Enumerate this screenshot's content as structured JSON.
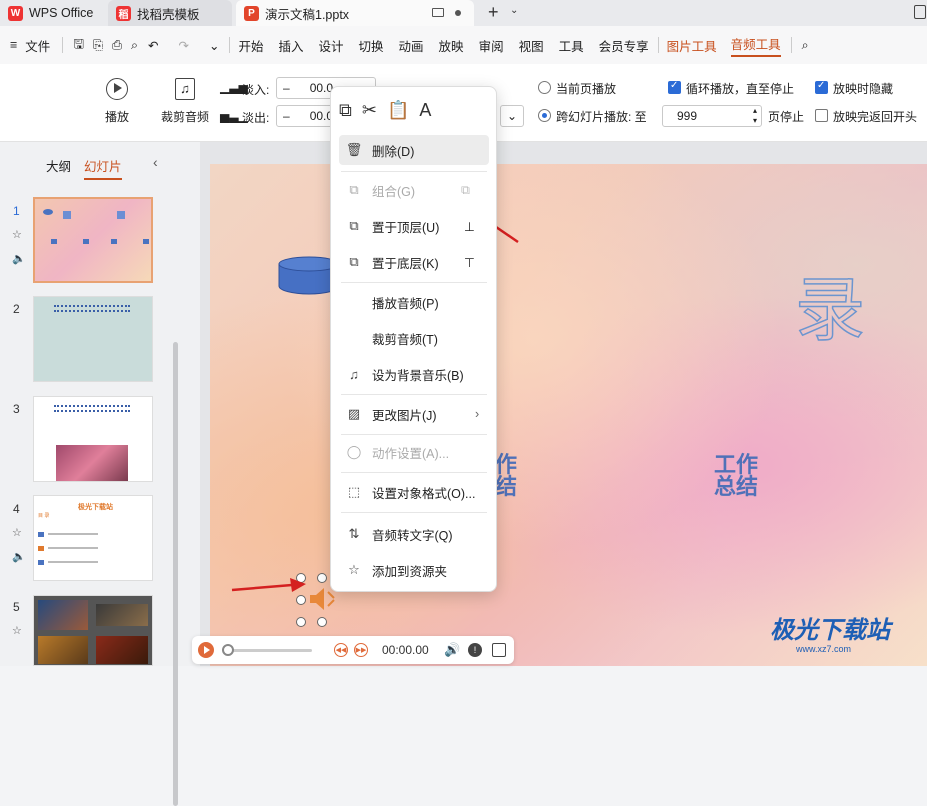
{
  "titlebar": {
    "tabs": [
      {
        "label": "WPS Office"
      },
      {
        "label": "找稻壳模板"
      },
      {
        "label": "演示文稿1.pptx"
      }
    ]
  },
  "menubar": {
    "file": "文件",
    "items": [
      "开始",
      "插入",
      "设计",
      "切换",
      "动画",
      "放映",
      "审阅",
      "视图",
      "工具",
      "会员专享"
    ],
    "context_tabs": [
      "图片工具",
      "音频工具"
    ]
  },
  "ribbon": {
    "play": "播放",
    "trim": "裁剪音频",
    "fade_in_label": "淡入:",
    "fade_in_value": "00.0",
    "fade_out_label": "淡出:",
    "fade_out_value": "00.0",
    "current_page_play": "当前页播放",
    "cross_slide_play": "跨幻灯片播放: 至",
    "page_stop_value": "999",
    "page_stop": "页停止",
    "loop_play": "循环播放，直至停止",
    "hide_on_show": "放映时隐藏",
    "rewind_after": "放映完返回开头",
    "accent_color": "#2b6bd6"
  },
  "leftpane": {
    "tab_outline": "大纲",
    "tab_slides": "幻灯片",
    "slides": [
      {
        "num": "1"
      },
      {
        "num": "2"
      },
      {
        "num": "3"
      },
      {
        "num": "4",
        "title": "极光下载站",
        "sub": "目 录"
      },
      {
        "num": "5"
      }
    ]
  },
  "slide": {
    "big_char": "录",
    "text_a": "作\n结",
    "text_b": "工作\n总结"
  },
  "context_menu": {
    "items": [
      {
        "label": "删除(D)",
        "icon": "trash-icon",
        "highlight": true
      },
      {
        "label": "组合(G)",
        "icon": "group-icon",
        "disabled": true
      },
      {
        "label": "置于顶层(U)",
        "icon": "bring-front-icon"
      },
      {
        "label": "置于底层(K)",
        "icon": "send-back-icon"
      },
      {
        "label": "播放音频(P)"
      },
      {
        "label": "裁剪音频(T)"
      },
      {
        "label": "设为背景音乐(B)",
        "icon": "music-note-icon"
      },
      {
        "label": "更改图片(J)",
        "icon": "image-icon"
      },
      {
        "label": "动作设置(A)...",
        "icon": "mouse-icon",
        "disabled": true
      },
      {
        "label": "设置对象格式(O)...",
        "icon": "format-icon"
      },
      {
        "label": "音频转文字(Q)",
        "icon": "audio-text-icon"
      },
      {
        "label": "添加到资源夹",
        "icon": "folder-star-icon"
      }
    ]
  },
  "player": {
    "time": "00:00.00"
  },
  "watermark": {
    "text": "极光下载站",
    "url": "www.xz7.com"
  }
}
